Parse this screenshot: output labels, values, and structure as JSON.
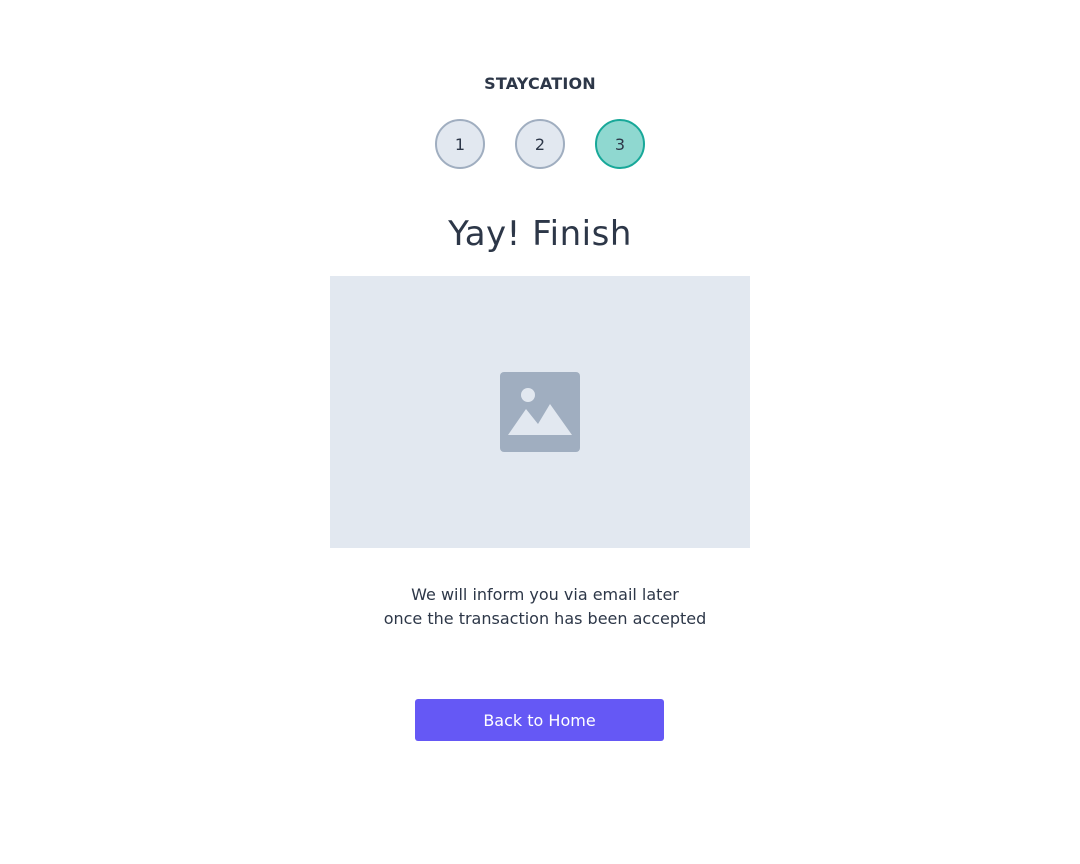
{
  "brand": "STAYCATION",
  "steps": [
    {
      "label": "1",
      "state": "inactive"
    },
    {
      "label": "2",
      "state": "inactive"
    },
    {
      "label": "3",
      "state": "active"
    }
  ],
  "heading": "Yay! Finish",
  "image": {
    "icon": "image-placeholder-icon"
  },
  "message": {
    "line1": "We will inform you via email later",
    "line2": "once the transaction has been accepted"
  },
  "button": {
    "label": "Back to Home"
  },
  "colors": {
    "primary": "#6558f5",
    "step_active_bg": "#8fd8d0",
    "step_active_border": "#18a899",
    "step_inactive_bg": "#e2e8f0",
    "step_inactive_border": "#a0aec0",
    "text": "#2d3748",
    "placeholder_bg": "#e2e8f0",
    "placeholder_icon": "#a0aec0"
  }
}
